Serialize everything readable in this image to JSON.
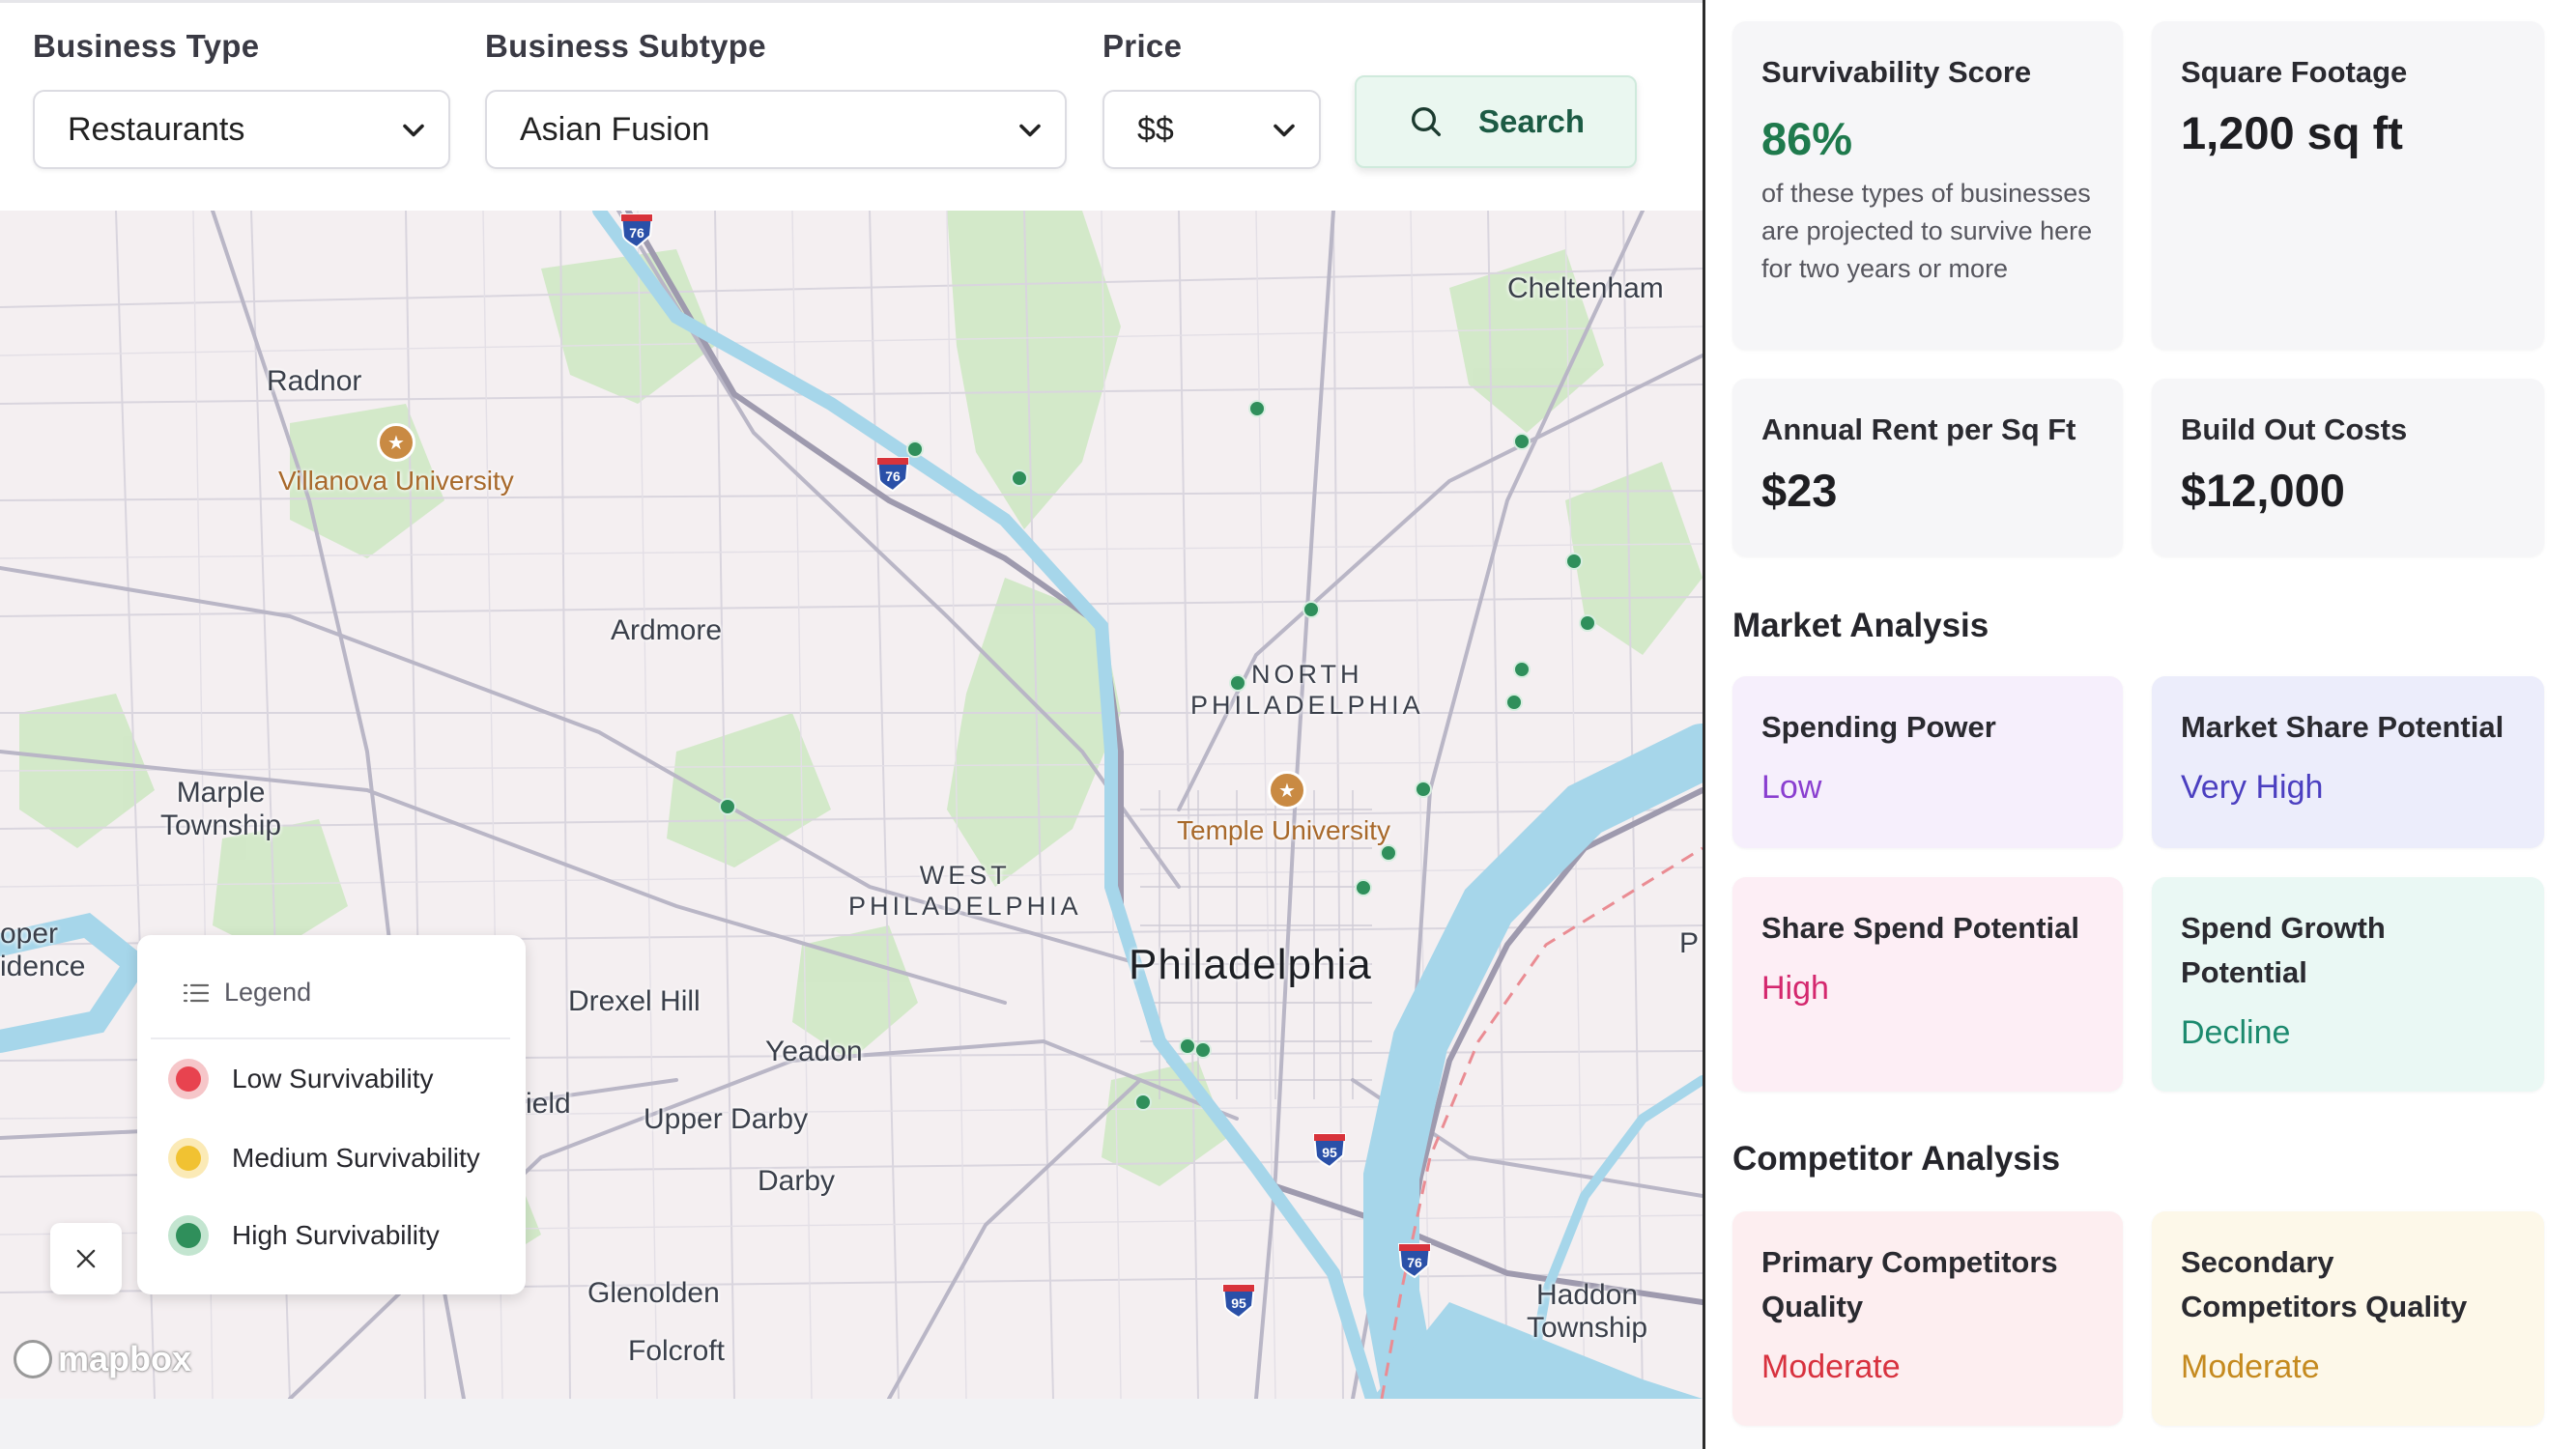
{
  "filters": {
    "business_type": {
      "label": "Business Type",
      "value": "Restaurants"
    },
    "business_subtype": {
      "label": "Business Subtype",
      "value": "Asian Fusion"
    },
    "price": {
      "label": "Price",
      "value": "$$"
    },
    "search_label": "Search"
  },
  "map": {
    "labels": {
      "cheltenham": "Cheltenham",
      "radnor": "Radnor",
      "villanova": "Villanova University",
      "ardmore": "Ardmore",
      "north_philadelphia": "NORTH\nPHILADELPHIA",
      "temple": "Temple University",
      "marple": "Marple\nTownship",
      "west_philadelphia": "WEST\nPHILADELPHIA",
      "philadelphia": "Philadelphia",
      "drexel_hill": "Drexel Hill",
      "yeadon": "Yeadon",
      "upper_darby": "Upper Darby",
      "darby": "Darby",
      "glenolden": "Glenolden",
      "folcroft": "Folcroft",
      "haddon": "Haddon\nTownship",
      "oper": "oper\nidence",
      "ield": "ield",
      "p_edge": "P"
    },
    "shields": {
      "i76": "76",
      "i95": "95"
    },
    "attribution": "mapbox"
  },
  "legend": {
    "title": "Legend",
    "items": [
      {
        "label": "Low Survivability",
        "color": "#e8434f",
        "ring": "#f6c6c9"
      },
      {
        "label": "Medium Survivability",
        "color": "#f1c232",
        "ring": "#fbeab6"
      },
      {
        "label": "High Survivability",
        "color": "#2f8f5b",
        "ring": "#c3e5d0"
      }
    ]
  },
  "panel": {
    "survivability": {
      "title": "Survivability Score",
      "value": "86%",
      "desc": "of these types of businesses are projected to survive here for two years or more",
      "color": "#1f7a4d"
    },
    "square_footage": {
      "title": "Square Footage",
      "value": "1,200 sq ft"
    },
    "annual_rent": {
      "title": "Annual Rent per Sq Ft",
      "value": "$23"
    },
    "build_out": {
      "title": "Build Out Costs",
      "value": "$12,000"
    },
    "market_analysis": {
      "heading": "Market Analysis",
      "spending_power": {
        "title": "Spending Power",
        "value": "Low",
        "color": "#8a3fd0",
        "bg": "#f6effc"
      },
      "market_share": {
        "title": "Market Share Potential",
        "value": "Very High",
        "color": "#4b3fc0",
        "bg": "#ecedfb"
      },
      "share_spend": {
        "title": "Share Spend Potential",
        "value": "High",
        "color": "#d4286e",
        "bg": "#fdeef5"
      },
      "spend_growth": {
        "title": "Spend Growth Potential",
        "value": "Decline",
        "color": "#1c8a6e",
        "bg": "#eaf8f4"
      }
    },
    "competitor_analysis": {
      "heading": "Competitor Analysis",
      "primary": {
        "title": "Primary Competitors Quality",
        "value": "Moderate",
        "color": "#d8323f",
        "bg": "#fdeef0"
      },
      "secondary": {
        "title": "Secondary Competitors Quality",
        "value": "Moderate",
        "color": "#c58a1f",
        "bg": "#fdf8e9"
      }
    }
  }
}
